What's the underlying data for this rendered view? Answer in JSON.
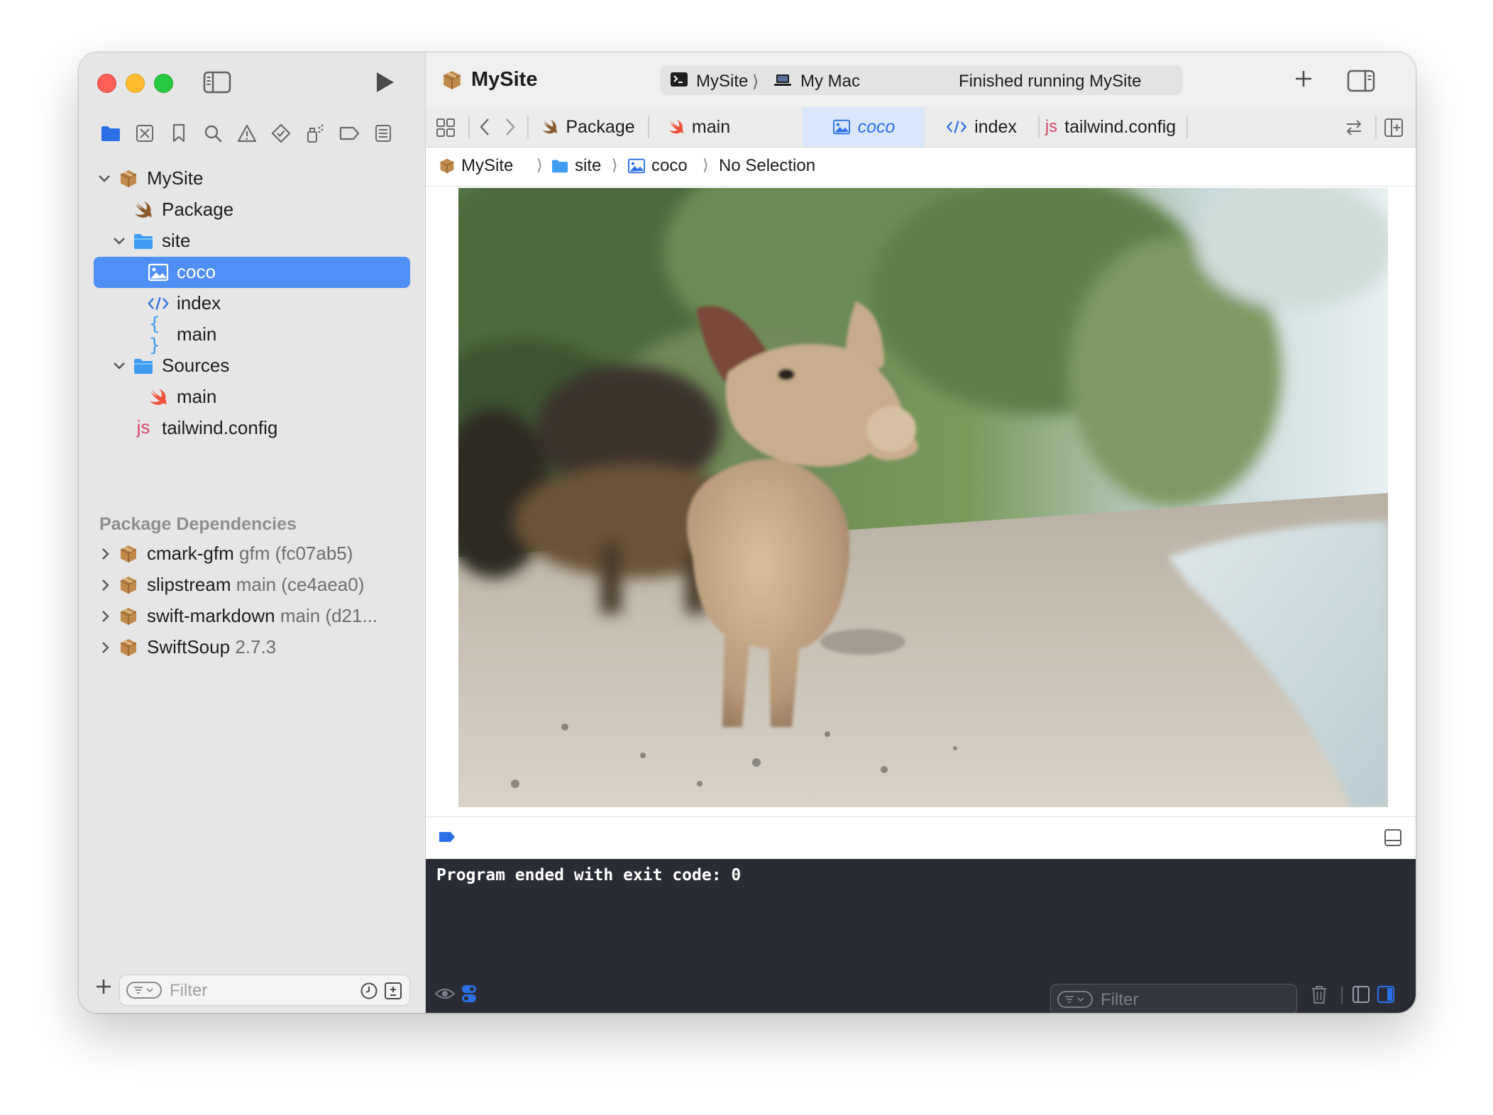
{
  "window": {
    "project_title": "MySite",
    "run_label": "Run"
  },
  "toolbar": {
    "scheme_name": "MySite",
    "destination": "My Mac",
    "status": "Finished running MySite"
  },
  "tabs": [
    {
      "label": "Package",
      "icon": "swift-icon",
      "active": false
    },
    {
      "label": "main",
      "icon": "swift-icon",
      "active": false
    },
    {
      "label": "coco",
      "icon": "image-icon",
      "active": true
    },
    {
      "label": "index",
      "icon": "html-icon",
      "active": false
    },
    {
      "label": "tailwind.config",
      "icon": "js-icon",
      "active": false
    }
  ],
  "breadcrumb": [
    {
      "label": "MySite",
      "icon": "package-icon"
    },
    {
      "label": "site",
      "icon": "folder-icon"
    },
    {
      "label": "coco",
      "icon": "image-icon"
    },
    {
      "label": "No Selection",
      "icon": ""
    }
  ],
  "navigator": {
    "items": [
      {
        "label": "MySite",
        "icon": "package-icon",
        "expanded": true
      },
      {
        "label": "Package",
        "icon": "swift-icon"
      },
      {
        "label": "site",
        "icon": "folder-icon",
        "expanded": true
      },
      {
        "label": "coco",
        "icon": "image-icon",
        "selected": true
      },
      {
        "label": "index",
        "icon": "html-icon"
      },
      {
        "label": "main",
        "icon": "json-icon"
      },
      {
        "label": "Sources",
        "icon": "folder-icon",
        "expanded": true
      },
      {
        "label": "main",
        "icon": "swift-icon"
      },
      {
        "label": "tailwind.config",
        "icon": "js-icon"
      }
    ],
    "dependencies_title": "Package Dependencies",
    "dependencies": [
      {
        "name": "cmark-gfm",
        "version": "gfm (fc07ab5)"
      },
      {
        "name": "slipstream",
        "version": "main (ce4aea0)"
      },
      {
        "name": "swift-markdown",
        "version": "main (d21..."
      },
      {
        "name": "SwiftSoup",
        "version": "2.7.3"
      }
    ],
    "filter_placeholder": "Filter",
    "js_glyph": "js"
  },
  "console": {
    "output": "Program ended with exit code: 0",
    "filter_placeholder": "Filter"
  },
  "colors": {
    "accent": "#2a6fe6",
    "selection": "#4f8ff6",
    "folder": "#3d9bf0",
    "swift": "#f05138",
    "package": "#c08a4c",
    "console_bg": "#2a2c35"
  }
}
